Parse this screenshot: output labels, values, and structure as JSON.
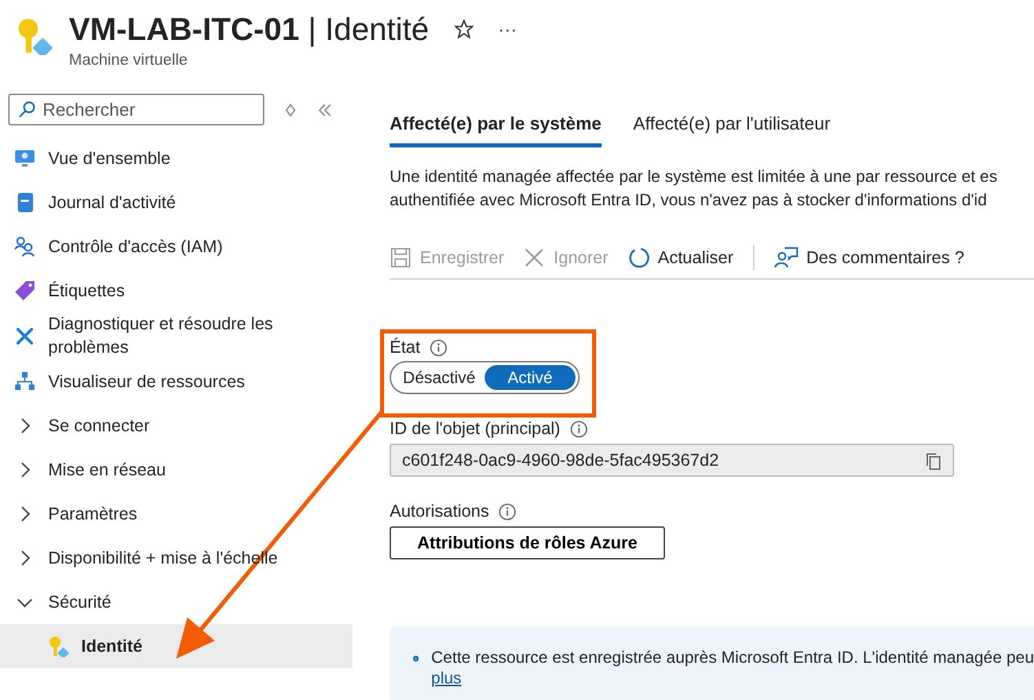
{
  "header": {
    "title": "VM-LAB-ITC-01",
    "separator": "|",
    "section": "Identité",
    "subtitle": "Machine virtuelle",
    "more": "···"
  },
  "sidebar": {
    "search": {
      "placeholder": "Rechercher"
    },
    "items": [
      {
        "label": "Vue d'ensemble",
        "kind": "page",
        "selected": false
      },
      {
        "label": "Journal d'activité",
        "kind": "page",
        "selected": false
      },
      {
        "label": "Contrôle d'accès (IAM)",
        "kind": "page",
        "selected": false
      },
      {
        "label": "Étiquettes",
        "kind": "page",
        "selected": false
      },
      {
        "label": "Diagnostiquer et résoudre les problèmes",
        "kind": "page",
        "selected": false
      },
      {
        "label": "Visualiseur de ressources",
        "kind": "page",
        "selected": false
      },
      {
        "label": "Se connecter",
        "kind": "group",
        "expanded": false,
        "selected": false
      },
      {
        "label": "Mise en réseau",
        "kind": "group",
        "expanded": false,
        "selected": false
      },
      {
        "label": "Paramètres",
        "kind": "group",
        "expanded": false,
        "selected": false
      },
      {
        "label": "Disponibilité + mise à l'échelle",
        "kind": "group",
        "expanded": false,
        "selected": false
      },
      {
        "label": "Sécurité",
        "kind": "group",
        "expanded": true,
        "selected": false,
        "children": [
          {
            "label": "Identité",
            "kind": "key",
            "selected": true
          }
        ]
      }
    ]
  },
  "tabs": [
    {
      "label": "Affecté(e) par le système",
      "selected": true
    },
    {
      "label": "Affecté(e) par l'utilisateur",
      "selected": false
    }
  ],
  "description": [
    "Une identité managée affectée par le système est limitée à une par ressource et es",
    "authentifiée avec Microsoft Entra ID, vous n'avez pas à stocker d'informations d'id"
  ],
  "toolbar": [
    {
      "label": "Enregistrer",
      "disabled": true
    },
    {
      "label": "Ignorer",
      "disabled": true
    },
    {
      "label": "Actualiser",
      "disabled": false
    },
    {
      "label": "Des commentaires ?",
      "disabled": false
    }
  ],
  "status": {
    "label": "État",
    "options": [
      {
        "label": "Désactivé",
        "selected": false
      },
      {
        "label": "Activé",
        "selected": true
      }
    ]
  },
  "object_id": {
    "label": "ID de l'objet (principal)",
    "value": "c601f248-0ac9-4960-98de-5fac495367d2"
  },
  "permissions": {
    "label": "Autorisations",
    "button": "Attributions de rôles Azure"
  },
  "info": {
    "text": "Cette ressource est enregistrée auprès Microsoft Entra ID. L'identité managée peu",
    "link": "plus"
  }
}
